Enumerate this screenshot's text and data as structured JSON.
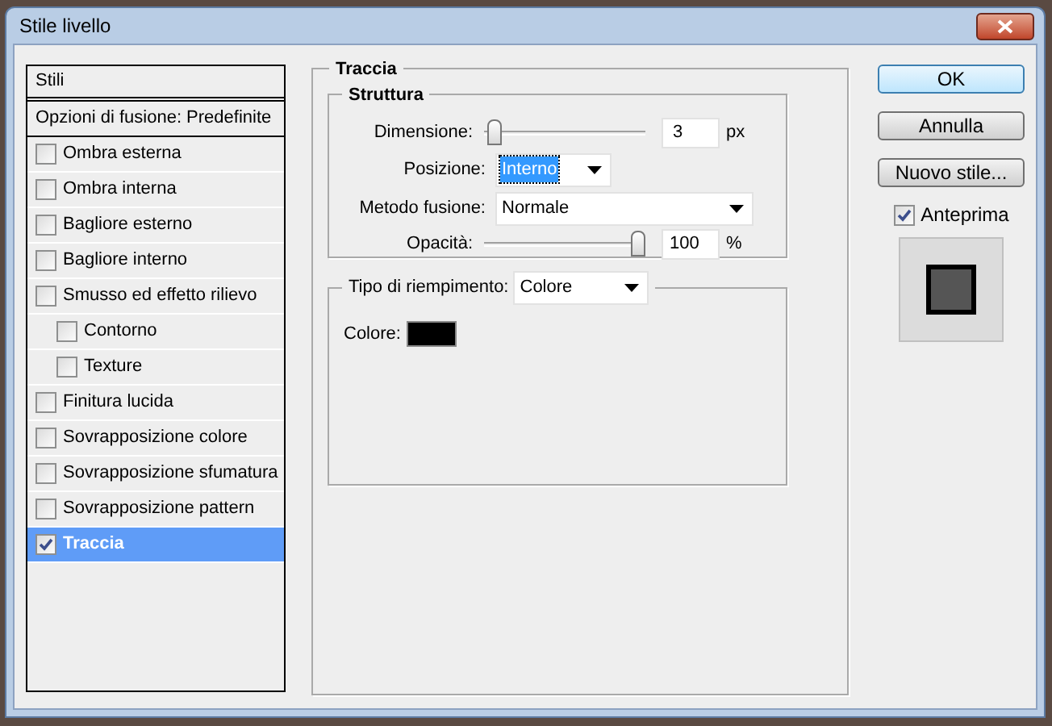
{
  "window": {
    "title": "Stile livello"
  },
  "styles_list": {
    "header": "Stili",
    "blend_options": "Opzioni di fusione: Predefinite",
    "items": [
      {
        "label": "Ombra esterna",
        "checked": false,
        "selected": false
      },
      {
        "label": "Ombra interna",
        "checked": false,
        "selected": false
      },
      {
        "label": "Bagliore esterno",
        "checked": false,
        "selected": false
      },
      {
        "label": "Bagliore interno",
        "checked": false,
        "selected": false
      },
      {
        "label": "Smusso ed effetto rilievo",
        "checked": false,
        "selected": false,
        "children": [
          {
            "label": "Contorno",
            "checked": false,
            "selected": false
          },
          {
            "label": "Texture",
            "checked": false,
            "selected": false
          }
        ]
      },
      {
        "label": "Finitura lucida",
        "checked": false,
        "selected": false
      },
      {
        "label": "Sovrapposizione colore",
        "checked": false,
        "selected": false
      },
      {
        "label": "Sovrapposizione sfumatura",
        "checked": false,
        "selected": false
      },
      {
        "label": "Sovrapposizione pattern",
        "checked": false,
        "selected": false
      },
      {
        "label": "Traccia",
        "checked": true,
        "selected": true
      }
    ]
  },
  "stroke": {
    "title": "Traccia",
    "structure": {
      "title": "Struttura",
      "size": {
        "label": "Dimensione:",
        "level": 0.02,
        "value": "3",
        "unit": "px"
      },
      "position": {
        "label": "Posizione:",
        "value": "Interno",
        "focused": true
      },
      "blend_mode": {
        "label": "Metodo fusione:",
        "value": "Normale",
        "focused": false
      },
      "opacity": {
        "label": "Opacità:",
        "level": 1,
        "value": "100",
        "unit": "%"
      }
    },
    "fill": {
      "label": "Tipo di riempimento:",
      "value": "Colore",
      "color_label": "Colore:",
      "color": "#000000"
    }
  },
  "buttons": [
    {
      "label": "OK",
      "default": true
    },
    {
      "label": "Annulla",
      "default": false
    },
    {
      "label": "Nuovo stile...",
      "default": false
    }
  ],
  "preview": {
    "label": "Anteprima",
    "checked": true
  }
}
